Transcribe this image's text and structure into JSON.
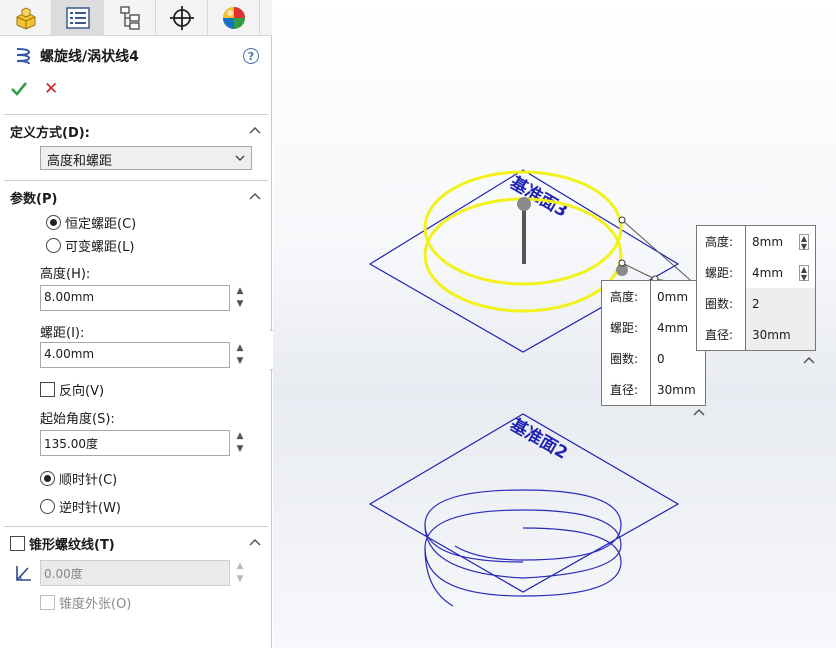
{
  "tabs": [
    {
      "name": "feature-manager",
      "active": false
    },
    {
      "name": "property-manager",
      "active": true
    },
    {
      "name": "configuration-manager",
      "active": false
    },
    {
      "name": "dimxpert-manager",
      "active": false
    },
    {
      "name": "display-manager",
      "active": false
    }
  ],
  "panel": {
    "title": "螺旋线/涡状线4",
    "help": "?",
    "ok_label": "✔",
    "cancel_label": "✕"
  },
  "definition": {
    "heading": "定义方式(D):",
    "selected": "高度和螺距"
  },
  "parameters": {
    "heading": "参数(P)",
    "constant_pitch": "恒定螺距(C)",
    "variable_pitch": "可变螺距(L)",
    "height_label": "高度(H):",
    "height_value": "8.00mm",
    "pitch_label": "螺距(I):",
    "pitch_value": "4.00mm",
    "reverse_label": "反向(V)",
    "start_angle_label": "起始角度(S):",
    "start_angle_value": "135.00度",
    "clockwise": "顺时针(C)",
    "counterclockwise": "逆时针(W)"
  },
  "taper": {
    "heading": "锥形螺纹线(T)",
    "angle_value": "0.00度",
    "outward_label": "锥度外张(O)"
  },
  "viewport": {
    "plane_top_label": "基准面3",
    "plane_bottom_label": "基准面2",
    "callout_left": [
      {
        "label": "高度:",
        "value": "0mm"
      },
      {
        "label": "螺距:",
        "value": "4mm"
      },
      {
        "label": "圈数:",
        "value": "0"
      },
      {
        "label": "直径:",
        "value": "30mm"
      }
    ],
    "callout_right": [
      {
        "label": "高度:",
        "value": "8mm"
      },
      {
        "label": "螺距:",
        "value": "4mm"
      },
      {
        "label": "圈数:",
        "value": "2"
      },
      {
        "label": "直径:",
        "value": "30mm"
      }
    ],
    "colors": {
      "plane": "#1f23b0",
      "helix_preview": "#f2f21a",
      "helix_existing": "#2a2ab8"
    }
  }
}
